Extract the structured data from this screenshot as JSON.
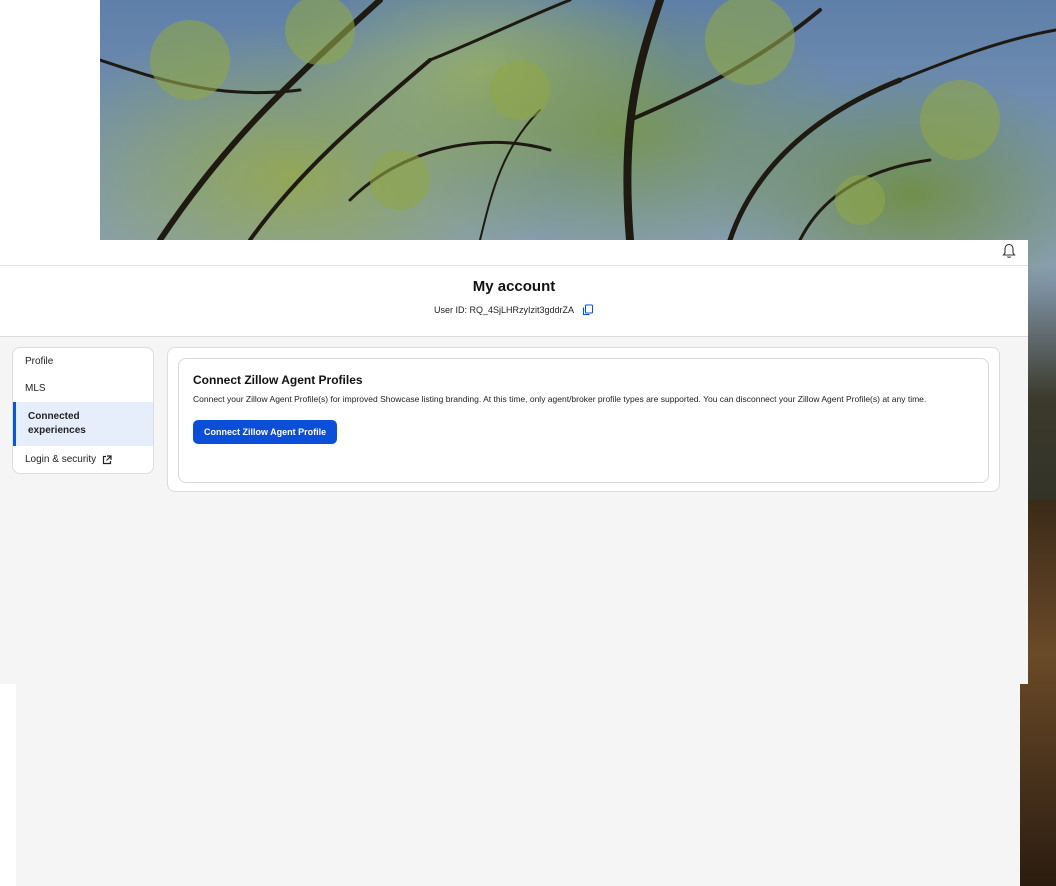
{
  "header": {
    "title": "My account",
    "user_id": "User ID: RQ_4SjLHRzyIzit3gddrZA"
  },
  "sidebar": {
    "items": [
      {
        "label": "Profile"
      },
      {
        "label": "MLS"
      },
      {
        "label": "Connected experiences"
      },
      {
        "label": "Login & security"
      }
    ]
  },
  "main": {
    "card_title": "Connect Zillow Agent Profiles",
    "card_description": "Connect your Zillow Agent Profile(s) for improved Showcase listing branding. At this time, only agent/broker profile types are supported. You can disconnect your Zillow Agent Profile(s) at any time.",
    "connect_button": "Connect Zillow Agent Profile"
  },
  "icons": {
    "bell": "bell-icon",
    "copy": "copy-icon",
    "external": "external-link-icon"
  },
  "colors": {
    "accent": "#0b4fd8",
    "active_bg": "#e6eefb"
  }
}
